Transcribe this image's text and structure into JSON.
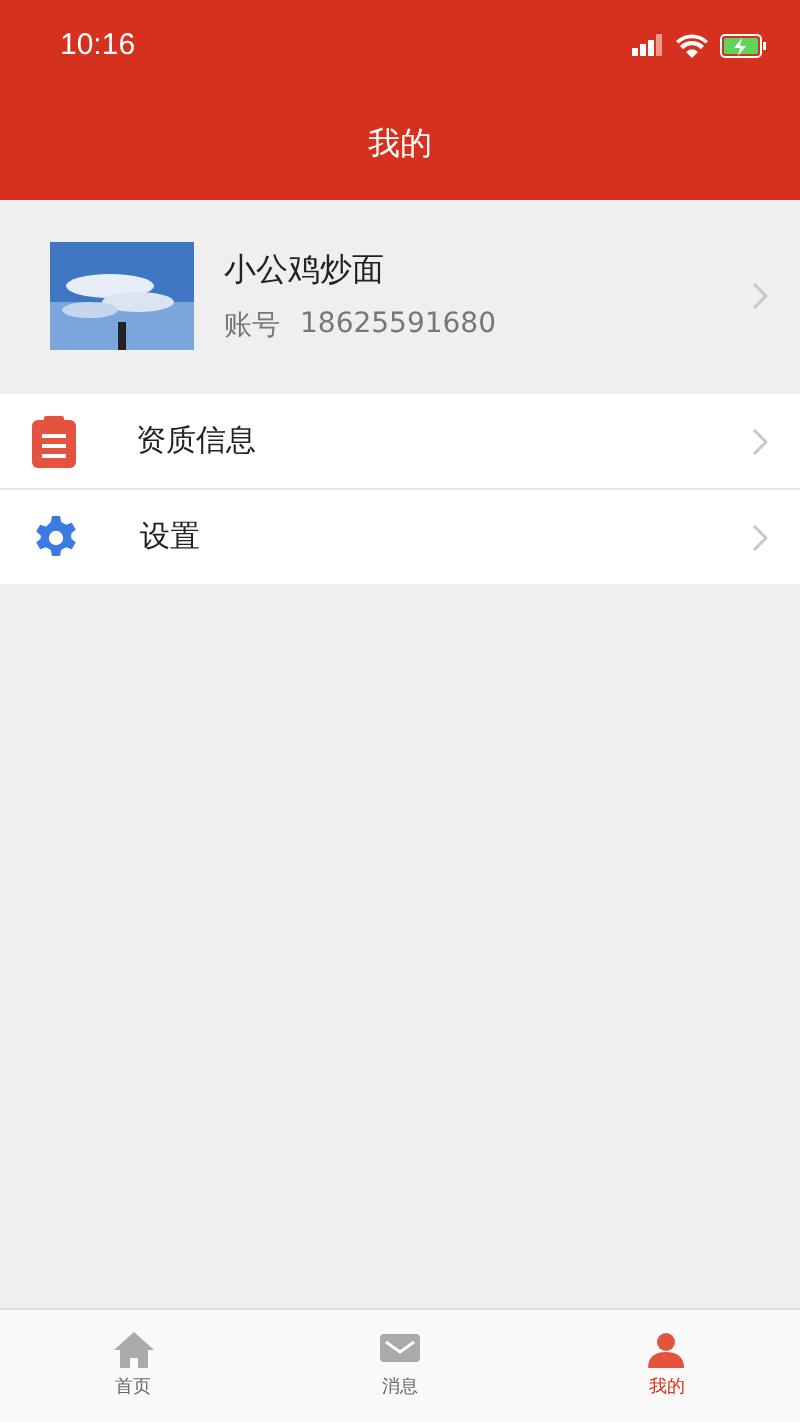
{
  "status_bar": {
    "time": "10:16"
  },
  "header": {
    "title": "我的"
  },
  "profile": {
    "name": "小公鸡炒面",
    "account_label": "账号",
    "account": "18625591680"
  },
  "menu": [
    {
      "kind": "qualification",
      "label": "资质信息"
    },
    {
      "kind": "settings",
      "label": "设置"
    }
  ],
  "tab_bar": [
    {
      "kind": "home",
      "label": "首页",
      "selected": false
    },
    {
      "kind": "message",
      "label": "消息",
      "selected": false
    },
    {
      "kind": "me",
      "label": "我的",
      "selected": true
    }
  ]
}
